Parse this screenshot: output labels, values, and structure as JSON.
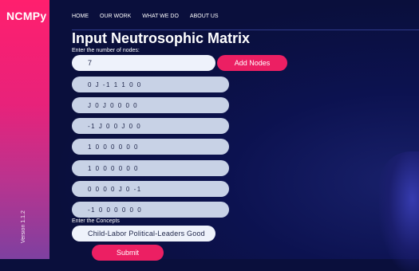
{
  "brand": "NCMPy",
  "version": "Version 1.1.2",
  "nav": [
    "HOME",
    "OUR WORK",
    "WHAT WE DO",
    "ABOUT US"
  ],
  "title": "Input Neutrosophic Matrix",
  "nodes_label": "Enter the number of nodes:",
  "nodes_value": "7",
  "add_nodes_label": "Add Nodes",
  "matrix_rows": [
    "0 J -1 1 1 0 0",
    "J 0 J 0 0 0 0",
    "-1 J 0 0 J 0 0",
    "1 0 0 0 0 0 0",
    "1 0 0 0 0 0 0",
    "0 0 0 0 J 0 -1",
    "-1 0 0 0 0 0 0"
  ],
  "concepts_label": "Enter the Concepts",
  "concepts_value": "Child-Labor Political-Leaders Good",
  "submit_label": "Submit",
  "colors": {
    "accent": "#ec1f63",
    "background": "#0a0f3c",
    "field": "#c8d2e6"
  }
}
